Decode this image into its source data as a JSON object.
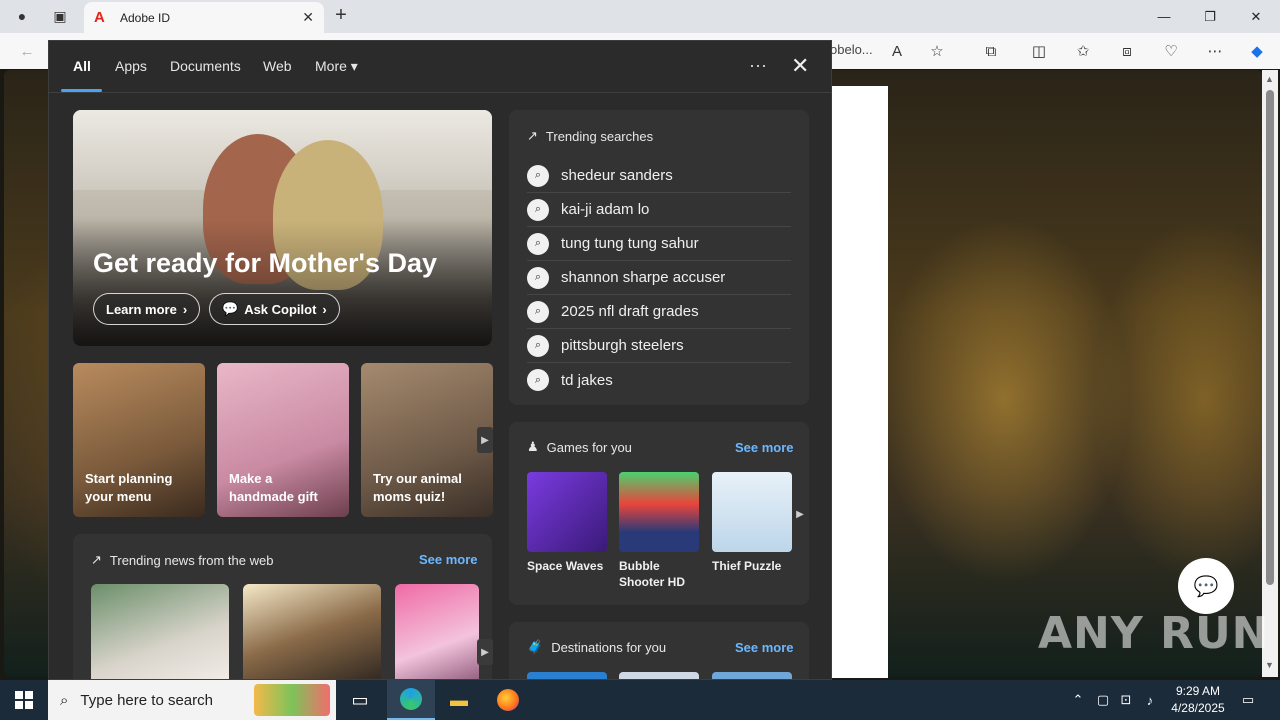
{
  "browser": {
    "tab_title": "Adobe ID",
    "tab_favicon": "A",
    "url_tail": "obelo...",
    "window_controls": [
      "minimize-icon",
      "restore-icon",
      "close-icon"
    ]
  },
  "panel": {
    "tabs": [
      "All",
      "Apps",
      "Documents",
      "Web",
      "More"
    ],
    "active_tab": "All",
    "hero": {
      "title": "Get ready for Mother's Day",
      "buttons": [
        "Learn more",
        "Ask Copilot"
      ]
    },
    "tiles": [
      {
        "label": "Start planning your menu"
      },
      {
        "label": "Make a handmade gift"
      },
      {
        "label": "Try our animal moms quiz!"
      }
    ],
    "trending": {
      "title": "Trending searches",
      "items": [
        "shedeur sanders",
        "kai-ji adam lo",
        "tung tung tung sahur",
        "shannon sharpe accuser",
        "2025 nfl draft grades",
        "pittsburgh steelers",
        "td jakes"
      ]
    },
    "news": {
      "title": "Trending news from the web",
      "see_more": "See more"
    },
    "games": {
      "title": "Games for you",
      "see_more": "See more",
      "items": [
        {
          "name": "Space Waves",
          "color": "#5b2ea6"
        },
        {
          "name": "Bubble Shooter HD",
          "color": "#2a3a78"
        },
        {
          "name": "Thief Puzzle",
          "color": "#cfe3f1"
        }
      ]
    },
    "destinations": {
      "title": "Destinations for you",
      "see_more": "See more"
    }
  },
  "taskbar": {
    "search_placeholder": "Type here to search",
    "time": "9:29 AM",
    "date": "4/28/2025"
  },
  "watermark": "ANY RUN",
  "colors": {
    "accent": "#4aa3f0",
    "link": "#6cb8ff",
    "panel_bg": "#2b2b2b",
    "card_bg": "#333333"
  }
}
